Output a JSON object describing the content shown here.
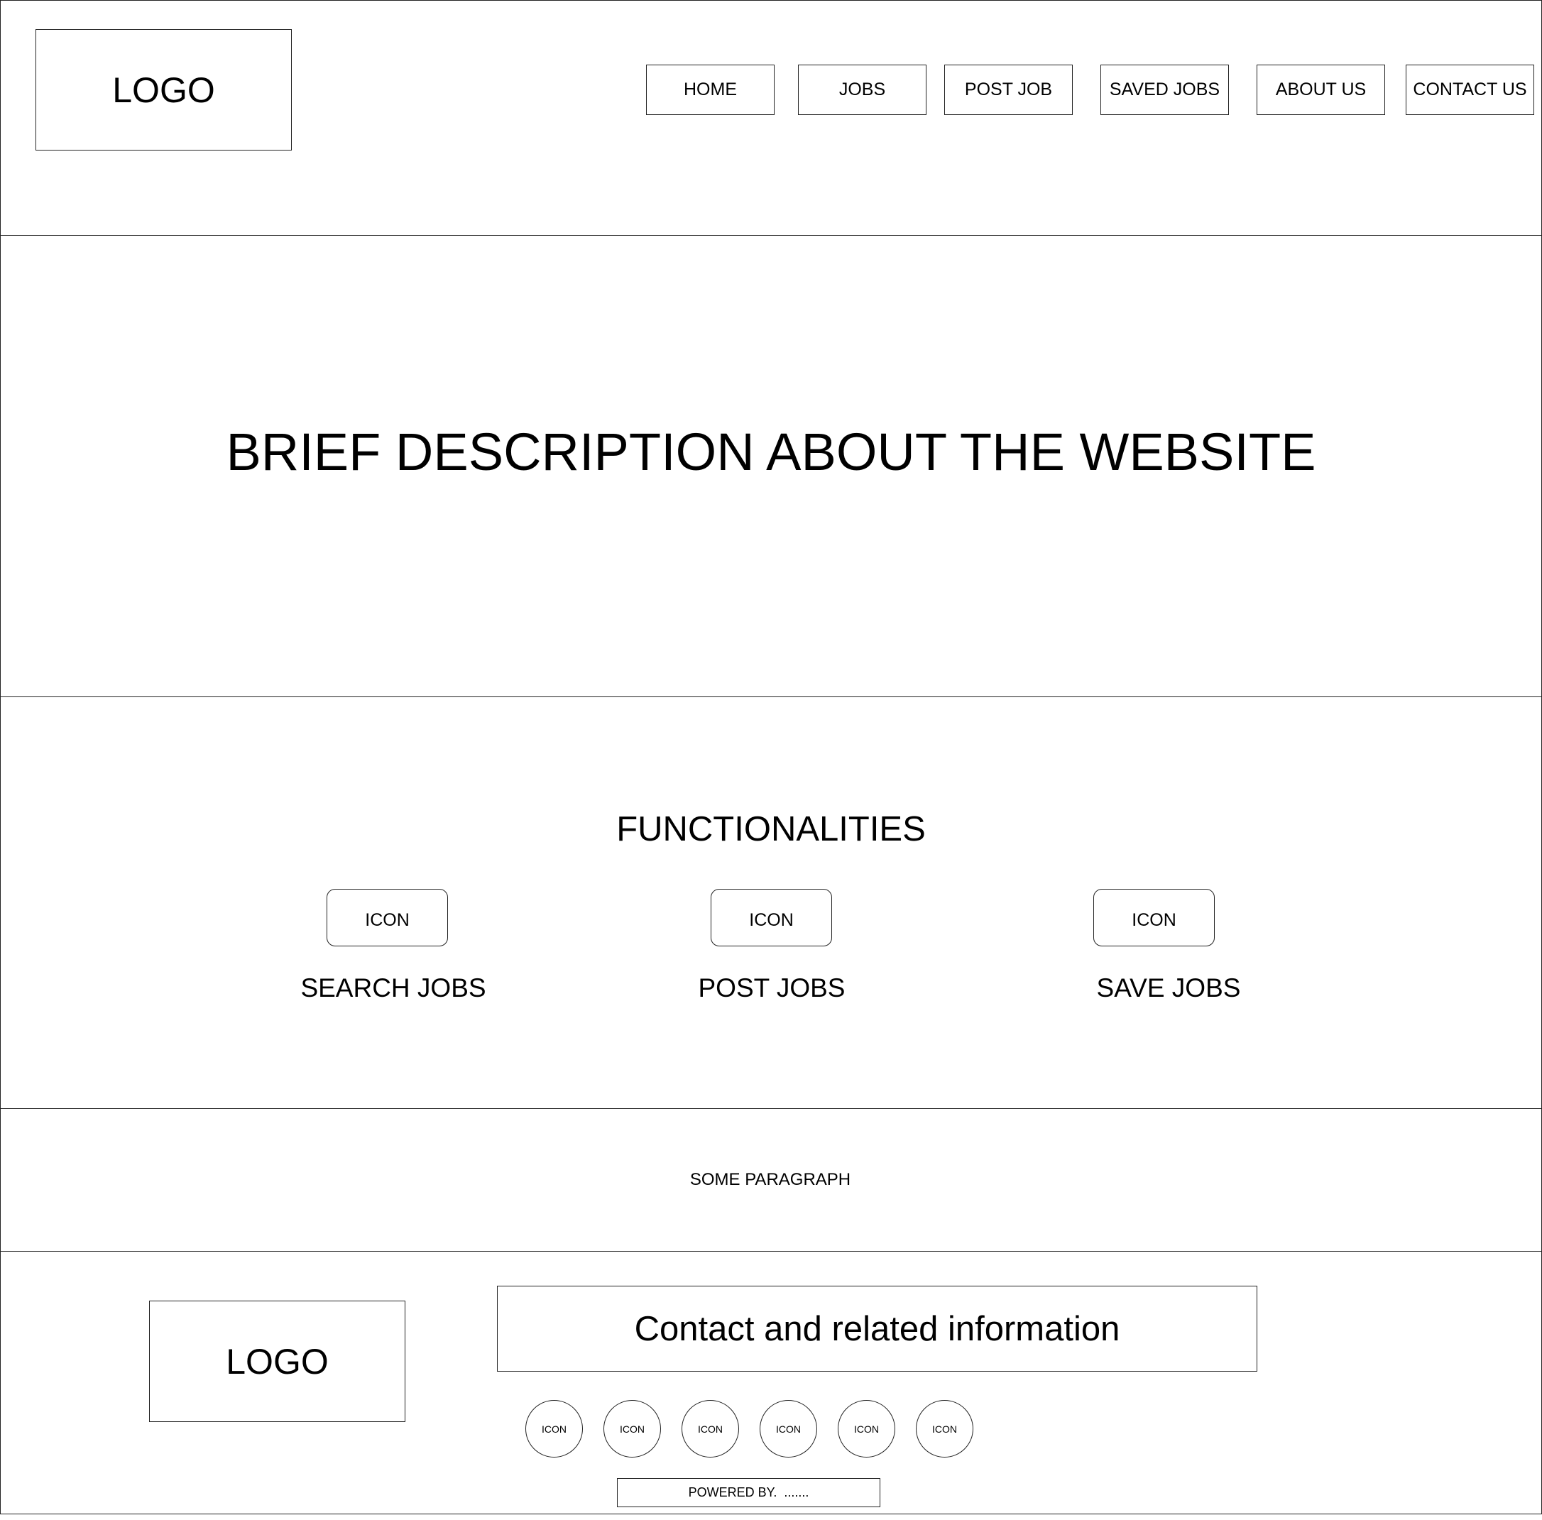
{
  "header": {
    "logo": "LOGO",
    "nav": [
      {
        "label": "HOME"
      },
      {
        "label": "JOBS"
      },
      {
        "label": "POST JOB"
      },
      {
        "label": "SAVED JOBS"
      },
      {
        "label": "ABOUT US"
      },
      {
        "label": "CONTACT US"
      }
    ]
  },
  "hero": {
    "title": "BRIEF DESCRIPTION ABOUT THE WEBSITE"
  },
  "features": {
    "heading": "FUNCTIONALITIES",
    "items": [
      {
        "icon_label": "ICON",
        "label": "SEARCH JOBS",
        "icon": "search-jobs-icon"
      },
      {
        "icon_label": "ICON",
        "label": "POST JOBS",
        "icon": "post-jobs-icon"
      },
      {
        "icon_label": "ICON",
        "label": "SAVE JOBS",
        "icon": "save-jobs-icon"
      }
    ]
  },
  "paragraph": {
    "text": "SOME PARAGRAPH"
  },
  "footer": {
    "logo": "LOGO",
    "contact": "Contact and related information",
    "social_icons": [
      {
        "label": "ICON"
      },
      {
        "label": "ICON"
      },
      {
        "label": "ICON"
      },
      {
        "label": "ICON"
      },
      {
        "label": "ICON"
      },
      {
        "label": "ICON"
      }
    ],
    "powered_by": "POWERED BY.  ......."
  }
}
